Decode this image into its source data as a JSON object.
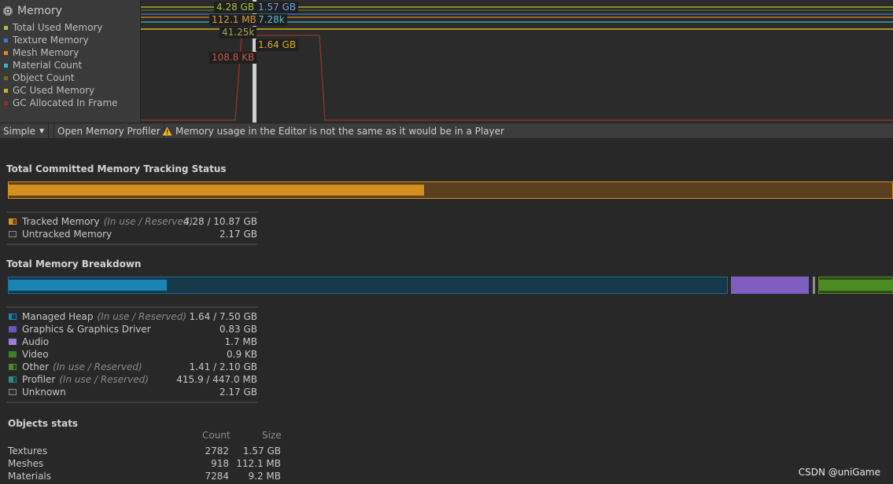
{
  "module": {
    "title": "Memory",
    "legend": [
      {
        "label": "Total Used Memory",
        "color": "#a9c23a"
      },
      {
        "label": "Texture Memory",
        "color": "#3b7bd0"
      },
      {
        "label": "Mesh Memory",
        "color": "#d98a1d"
      },
      {
        "label": "Material Count",
        "color": "#3fb6c4"
      },
      {
        "label": "Object Count",
        "color": "#6d6d22"
      },
      {
        "label": "GC Used Memory",
        "color": "#d7b11b"
      },
      {
        "label": "GC Allocated In Frame",
        "color": "#8b3523"
      }
    ],
    "tooltips": {
      "total_used": "4.28 GB",
      "texture": "1.57 GB",
      "mesh": "112.1 MB",
      "material_count": "7.28k",
      "object_count": "41.25k",
      "gc_used": "1.64 GB",
      "gc_alloc": "108.8 KB"
    }
  },
  "toolbar": {
    "view_mode": "Simple",
    "open_profiler": "Open Memory Profiler",
    "warning": "Memory usage in the Editor is not the same as it would be in a Player"
  },
  "tracking": {
    "title": "Total Committed Memory Tracking Status",
    "fill_fraction": 0.47,
    "rows": [
      {
        "label": "Tracked Memory",
        "note": "(In use / Reserved)",
        "value": "4.28 / 10.87 GB"
      },
      {
        "label": "Untracked Memory",
        "note": "",
        "value": "2.17 GB"
      }
    ]
  },
  "breakdown": {
    "title": "Total Memory Breakdown",
    "managed_fill_fraction": 0.22,
    "rows": [
      {
        "label": "Managed Heap",
        "note": "(In use / Reserved)",
        "value": "1.64 / 7.50 GB"
      },
      {
        "label": "Graphics & Graphics Driver",
        "note": "",
        "value": "0.83 GB"
      },
      {
        "label": "Audio",
        "note": "",
        "value": "1.7 MB"
      },
      {
        "label": "Video",
        "note": "",
        "value": "0.9 KB"
      },
      {
        "label": "Other",
        "note": "(In use / Reserved)",
        "value": "1.41 / 2.10 GB"
      },
      {
        "label": "Profiler",
        "note": "(In use / Reserved)",
        "value": "415.9 / 447.0 MB"
      },
      {
        "label": "Unknown",
        "note": "",
        "value": "2.17 GB"
      }
    ]
  },
  "objects": {
    "title": "Objects stats",
    "col_count": "Count",
    "col_size": "Size",
    "rows": [
      {
        "name": "Textures",
        "count": "2782",
        "size": "1.57 GB"
      },
      {
        "name": "Meshes",
        "count": "918",
        "size": "112.1 MB"
      },
      {
        "name": "Materials",
        "count": "7284",
        "size": "9.2 MB"
      }
    ]
  },
  "watermark": "CSDN @uniGame"
}
